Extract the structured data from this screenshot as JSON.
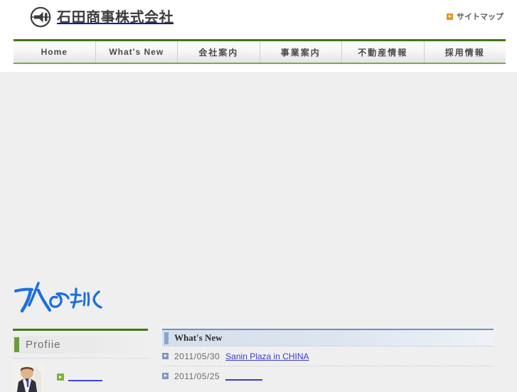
{
  "site": {
    "company_name": "石田商事株式会社",
    "logo_icon": "megaphone-circle-logo"
  },
  "header": {
    "sitemap": {
      "label": "サイトマップ",
      "icon": "orange-arrow-icon",
      "icon_color": "#e8941a"
    }
  },
  "nav": {
    "items": [
      {
        "label": "Home",
        "lang": "en"
      },
      {
        "label": "What's New",
        "lang": "en"
      },
      {
        "label": "会社案内",
        "lang": "jp"
      },
      {
        "label": "事業案内",
        "lang": "jp"
      },
      {
        "label": "不動産情報",
        "lang": "jp"
      },
      {
        "label": "採用情報",
        "lang": "jp"
      }
    ],
    "top_border_color": "#3f7a18",
    "bottom_border_color": "#7aab4e"
  },
  "hero": {
    "calligraphy_alt": "水のゆくさ",
    "calligraphy_color": "#1d6fe0"
  },
  "profile": {
    "title": "Profiie",
    "accent_color": "#6c9a3f",
    "top_rule_color": "#3f7a18",
    "photo_alt": "businessman-portrait",
    "link_icon": "green-arrow-icon",
    "link_label": ""
  },
  "news": {
    "title": "What's New",
    "accent_color": "#8ba4c9",
    "top_rule_color": "#6f91c4",
    "items": [
      {
        "date": "2011/05/30",
        "link_text": "Sanin Plaza in CHINA",
        "blank": false
      },
      {
        "date": "2011/05/25",
        "link_text": "",
        "blank": true
      }
    ]
  },
  "colors": {
    "page_background": "#efefef",
    "header_background": "#ffffff",
    "link": "#3b3bd0"
  }
}
